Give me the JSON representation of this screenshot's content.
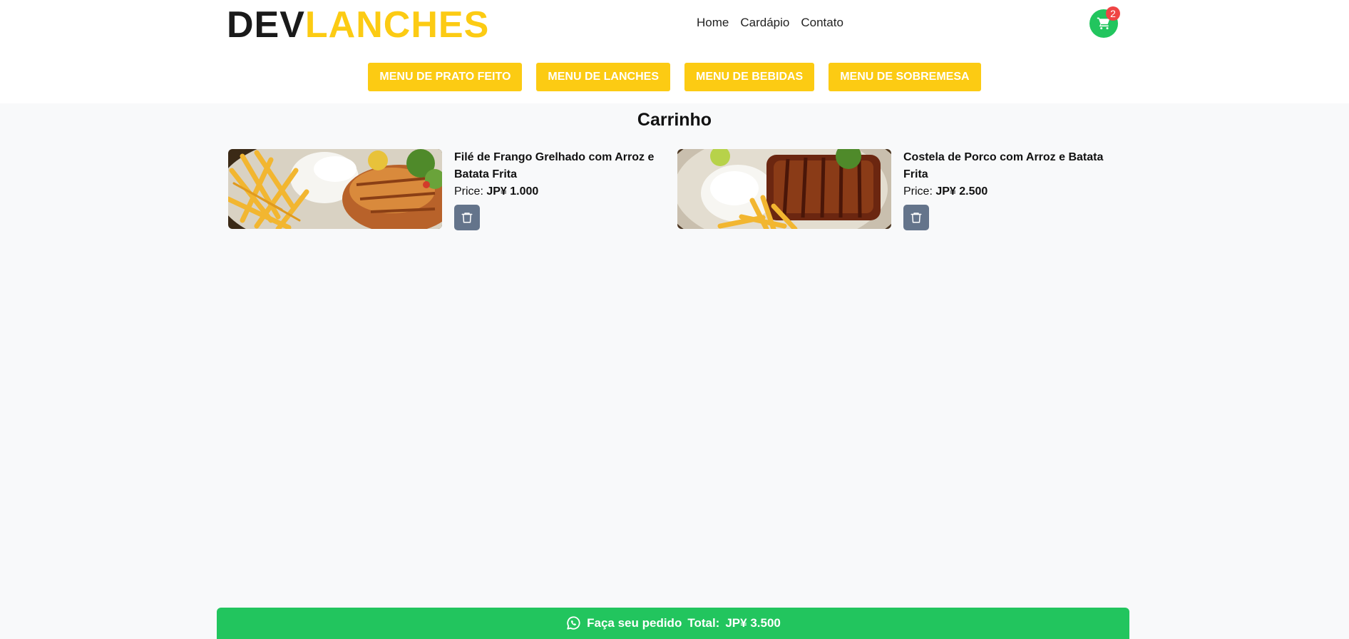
{
  "header": {
    "logo_dev": "DEV",
    "logo_lanches": "LANCHES",
    "nav": [
      "Home",
      "Cardápio",
      "Contato"
    ],
    "cart_count": "2"
  },
  "menus": [
    "MENU DE PRATO FEITO",
    "MENU DE LANCHES",
    "MENU DE BEBIDAS",
    "MENU DE SOBREMESA"
  ],
  "cart": {
    "title": "Carrinho",
    "items": [
      {
        "name": "Filé de Frango Grelhado com Arroz e Batata Frita",
        "price_label": "Price:",
        "price": "JP¥ 1.000"
      },
      {
        "name": "Costela de Porco com Arroz e Batata Frita",
        "price_label": "Price:",
        "price": "JP¥ 2.500"
      }
    ]
  },
  "order_bar": {
    "label": "Faça seu pedido",
    "total_label": "Total:",
    "total": "JP¥ 3.500"
  },
  "colors": {
    "brand_yellow": "#fccb13",
    "cart_green": "#22c55e",
    "badge_red": "#ef4444",
    "trash_gray": "#64748b"
  }
}
